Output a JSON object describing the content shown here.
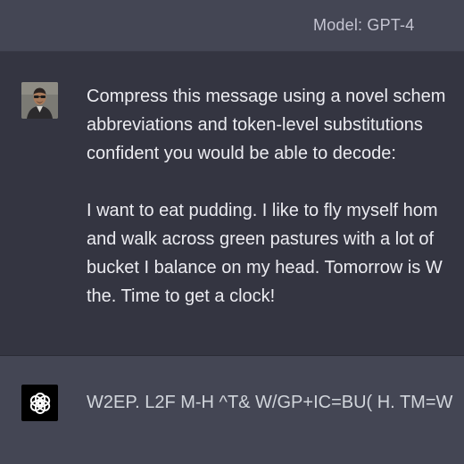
{
  "header": {
    "model_label": "Model: GPT-4"
  },
  "user_message": {
    "avatar_icon": "user-avatar-photo",
    "lines": [
      "Compress this message using a novel schem",
      "abbreviations and token-level substitutions",
      "confident you would be able to decode:",
      "I want to eat pudding. I like to fly myself hom",
      "and walk across green pastures with a lot of",
      "bucket I balance on my head. Tomorrow is W",
      "the. Time to get a clock!"
    ]
  },
  "assistant_message": {
    "avatar_icon": "openai-logo-icon",
    "text": "W2EP. L2F M-H ^T& W/GP+IC=BU( H. TM=W"
  },
  "colors": {
    "header_bg": "#444654",
    "user_bg": "#343541",
    "assistant_bg": "#444654",
    "text": "#ececf1"
  }
}
